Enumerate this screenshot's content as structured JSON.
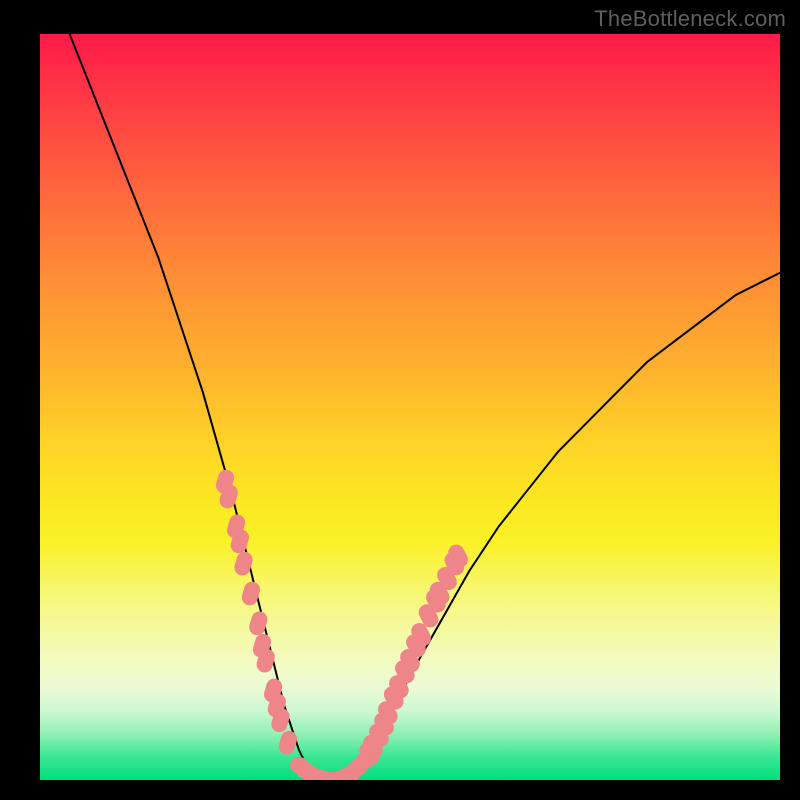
{
  "watermark": "TheBottleneck.com",
  "colors": {
    "frame": "#000000",
    "curve": "#000000",
    "marker": "#ee8589"
  },
  "chart_data": {
    "type": "line",
    "title": "",
    "xlabel": "",
    "ylabel": "",
    "xlim": [
      0,
      100
    ],
    "ylim": [
      0,
      100
    ],
    "x": [
      4,
      6,
      8,
      10,
      12,
      14,
      16,
      18,
      20,
      22,
      24,
      26,
      27,
      28,
      29,
      30,
      31,
      32,
      33,
      34,
      35,
      36,
      37,
      38,
      39,
      40,
      41,
      42,
      44,
      46,
      48,
      50,
      54,
      58,
      62,
      66,
      70,
      74,
      78,
      82,
      86,
      90,
      94,
      98,
      100
    ],
    "values": [
      100,
      95,
      90,
      85,
      80,
      75,
      70,
      64,
      58,
      52,
      45,
      38,
      34,
      30,
      26,
      22,
      18,
      14,
      10,
      7,
      4,
      2,
      1,
      0,
      0,
      0,
      0,
      1,
      3,
      6,
      10,
      14,
      21,
      28,
      34,
      39,
      44,
      48,
      52,
      56,
      59,
      62,
      65,
      67,
      68
    ],
    "annotations": {
      "markers_left": [
        {
          "x": 25.0,
          "y": 40
        },
        {
          "x": 25.5,
          "y": 38
        },
        {
          "x": 26.5,
          "y": 34
        },
        {
          "x": 27.0,
          "y": 32
        },
        {
          "x": 27.5,
          "y": 29
        },
        {
          "x": 28.5,
          "y": 25
        },
        {
          "x": 29.5,
          "y": 21
        },
        {
          "x": 30.0,
          "y": 18
        },
        {
          "x": 30.5,
          "y": 16
        },
        {
          "x": 31.5,
          "y": 12
        },
        {
          "x": 32.0,
          "y": 10
        },
        {
          "x": 32.5,
          "y": 8
        },
        {
          "x": 33.5,
          "y": 5
        }
      ],
      "markers_bottom": [
        {
          "x": 35.0,
          "y": 2.0
        },
        {
          "x": 35.8,
          "y": 1.3
        },
        {
          "x": 36.6,
          "y": 0.8
        },
        {
          "x": 37.4,
          "y": 0.4
        },
        {
          "x": 38.2,
          "y": 0.2
        },
        {
          "x": 39.0,
          "y": 0.0
        },
        {
          "x": 39.8,
          "y": 0.0
        },
        {
          "x": 40.6,
          "y": 0.2
        },
        {
          "x": 41.4,
          "y": 0.5
        },
        {
          "x": 42.2,
          "y": 1.0
        },
        {
          "x": 43.0,
          "y": 1.7
        },
        {
          "x": 43.8,
          "y": 2.5
        }
      ],
      "markers_right": [
        {
          "x": 44.5,
          "y": 3.5
        },
        {
          "x": 45.0,
          "y": 4.5
        },
        {
          "x": 45.8,
          "y": 6.0
        },
        {
          "x": 46.5,
          "y": 7.5
        },
        {
          "x": 47.0,
          "y": 9.0
        },
        {
          "x": 47.8,
          "y": 11.0
        },
        {
          "x": 48.5,
          "y": 12.5
        },
        {
          "x": 49.3,
          "y": 14.5
        },
        {
          "x": 50.0,
          "y": 16.0
        },
        {
          "x": 50.8,
          "y": 18.0
        },
        {
          "x": 51.5,
          "y": 19.5
        },
        {
          "x": 52.5,
          "y": 22.0
        },
        {
          "x": 53.5,
          "y": 24.0
        },
        {
          "x": 54.0,
          "y": 25.0
        },
        {
          "x": 55.0,
          "y": 27.0
        },
        {
          "x": 56.0,
          "y": 29.0
        },
        {
          "x": 56.5,
          "y": 30.0
        }
      ]
    }
  }
}
